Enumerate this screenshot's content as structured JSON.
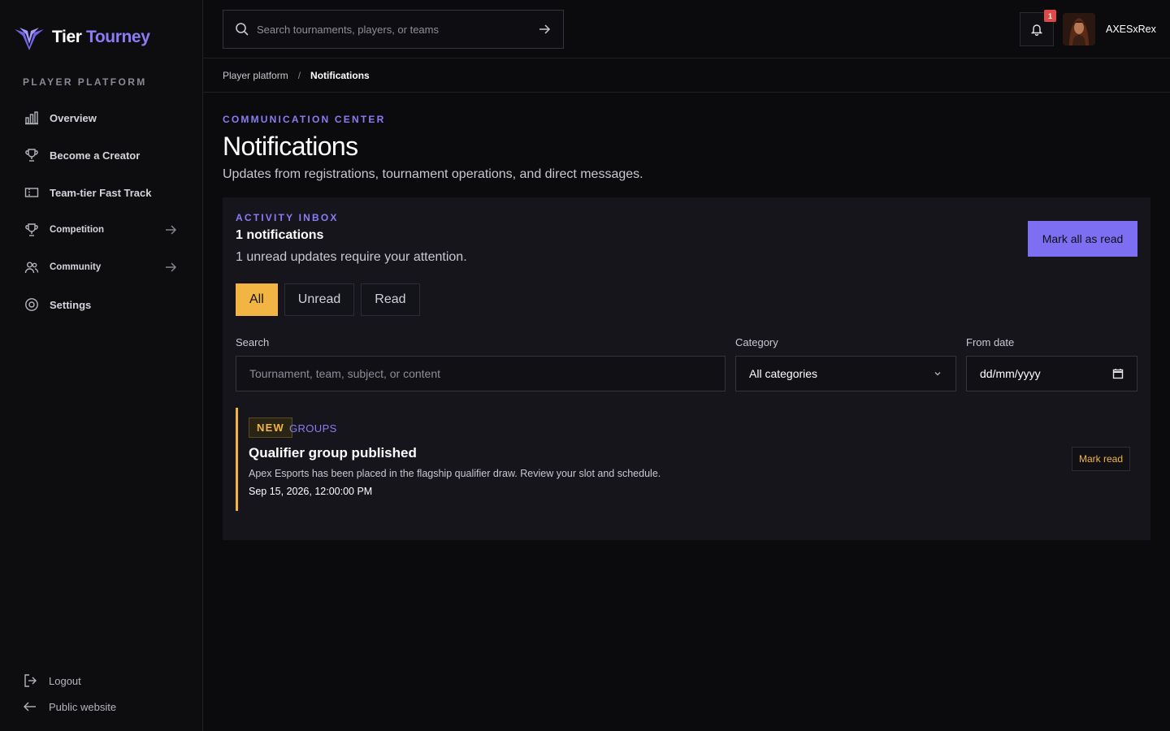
{
  "brand": {
    "name_part1": "Tier",
    "name_part2": "Tourney",
    "accent": "#8b7cf6",
    "highlight": "#f2b544"
  },
  "sidebar": {
    "section_label": "PLAYER PLATFORM",
    "items": [
      {
        "label": "Overview",
        "icon": "bar-chart-icon"
      },
      {
        "label": "Become a Creator",
        "icon": "trophy-icon"
      },
      {
        "label": "Team-tier Fast Track",
        "icon": "ticket-icon"
      },
      {
        "label": "Competition",
        "icon": "trophy-icon",
        "has_arrow": true
      },
      {
        "label": "Community",
        "icon": "users-icon",
        "has_arrow": true
      },
      {
        "label": "Settings",
        "icon": "gear-icon"
      }
    ],
    "bottom": [
      {
        "label": "Logout",
        "icon": "logout-icon"
      },
      {
        "label": "Public website",
        "icon": "arrow-left-icon"
      }
    ]
  },
  "topbar": {
    "search_placeholder": "Search tournaments, players, or teams",
    "notification_count": "1",
    "username": "AXESxRex"
  },
  "breadcrumb": {
    "parent": "Player platform",
    "separator": "/",
    "current": "Notifications"
  },
  "header": {
    "eyebrow": "COMMUNICATION CENTER",
    "title": "Notifications",
    "subtitle": "Updates from registrations, tournament operations, and direct messages."
  },
  "inbox": {
    "eyebrow": "ACTIVITY INBOX",
    "count_text": "1 notifications",
    "unread_text": "1 unread updates require your attention.",
    "mark_all_label": "Mark all as read",
    "tabs": [
      {
        "label": "All",
        "active": true
      },
      {
        "label": "Unread",
        "active": false
      },
      {
        "label": "Read",
        "active": false
      }
    ],
    "filters": {
      "search_label": "Search",
      "search_placeholder": "Tournament, team, subject, or content",
      "category_label": "Category",
      "category_value": "All categories",
      "date_label": "From date",
      "date_value": "dd/mm/yyyy"
    },
    "notifications": [
      {
        "badge": "NEW",
        "category": "GROUPS",
        "title": "Qualifier group published",
        "body": "Apex Esports has been placed in the flagship qualifier draw. Review your slot and schedule.",
        "date": "Sep 15, 2026, 12:00:00 PM",
        "action_label": "Mark read"
      }
    ]
  }
}
